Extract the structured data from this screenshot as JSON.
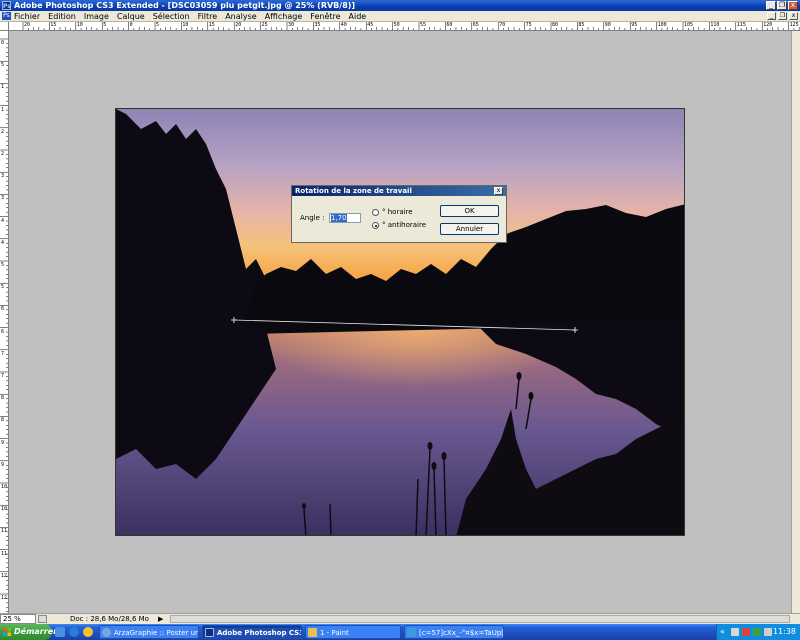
{
  "window": {
    "title": "Adobe Photoshop CS3 Extended - [DSC03059 plu petgit.jpg @ 25% (RVB/8)]",
    "app_icon": "Ps",
    "buttons": [
      "_",
      "❐",
      "x"
    ]
  },
  "menubar": {
    "items": [
      "Fichier",
      "Edition",
      "Image",
      "Calque",
      "Sélection",
      "Filtre",
      "Analyse",
      "Affichage",
      "Fenêtre",
      "Aide"
    ],
    "doc_buttons": [
      "_",
      "❐",
      "x"
    ]
  },
  "ruler": {
    "top_labels": [
      "20",
      "15",
      "10",
      "5",
      "0",
      "5",
      "10",
      "15",
      "20",
      "25",
      "30",
      "35",
      "40",
      "45",
      "50",
      "55",
      "60",
      "65",
      "70",
      "75",
      "80",
      "85",
      "90",
      "95",
      "100",
      "105",
      "110",
      "115",
      "120",
      "125"
    ],
    "left_labels": [
      "0",
      "5",
      "1",
      "1",
      "2",
      "2",
      "3",
      "3",
      "4",
      "4",
      "5",
      "5",
      "6",
      "6",
      "7",
      "7",
      "8",
      "8",
      "9",
      "9",
      "10",
      "10",
      "11",
      "11",
      "12",
      "12"
    ]
  },
  "dialog": {
    "title": "Rotation de la zone de travail",
    "angle_label": "Angle :",
    "angle_value": "1,70",
    "option_clockwise": "° horaire",
    "option_counterclockwise": "° antihoraire",
    "selected_option": "antihoraire",
    "ok_label": "OK",
    "cancel_label": "Annuler",
    "close_label": "x"
  },
  "statusbar": {
    "zoom": "25 %",
    "doc_info": "Doc : 28,6 Mo/28,6 Mo"
  },
  "taskbar": {
    "start_label": "Démarrer",
    "tasks": [
      {
        "label": "ArzaGraphie :: Poster un...",
        "active": false,
        "icon_color": "#7aa7d8"
      },
      {
        "label": "Adobe Photoshop CS3...",
        "active": true,
        "icon_color": "#0f2f7a"
      },
      {
        "label": "1 - Paint",
        "active": false,
        "icon_color": "#e8c050"
      },
      {
        "label": "[c=57]cXx_-°¤$x=TaUp[...",
        "active": false,
        "icon_color": "#3a9be0"
      }
    ],
    "clock": "11:38"
  },
  "colors": {
    "titlebar": "#0a3fb0",
    "dialog_title": "#0a246a",
    "canvas_bg": "#c0c0c0",
    "taskbar": "#245edb",
    "start_button": "#3c9c3c"
  }
}
